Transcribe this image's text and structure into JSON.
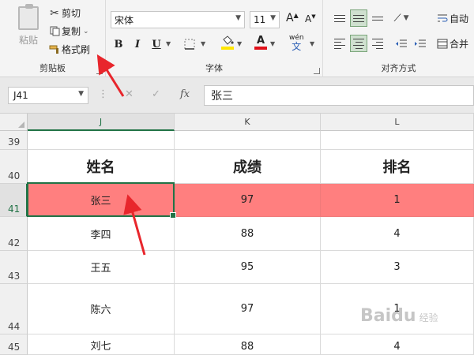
{
  "ribbon": {
    "clipboard": {
      "paste_label": "粘贴",
      "cut_label": "剪切",
      "copy_label": "复制",
      "format_painter_label": "格式刷",
      "group_label": "剪贴板"
    },
    "font": {
      "font_name": "宋体",
      "font_size": "11",
      "grow_label": "A",
      "shrink_label": "A",
      "bold": "B",
      "italic": "I",
      "underline": "U",
      "font_color_label": "A",
      "phonetic_top": "wén",
      "phonetic_bottom": "文",
      "group_label": "字体",
      "fill_color": "#ffe600",
      "font_color": "#e0101a"
    },
    "alignment": {
      "wrap_label": "自动",
      "merge_label": "合并",
      "group_label": "对齐方式"
    }
  },
  "formula_bar": {
    "name_box": "J41",
    "cancel_icon": "✕",
    "enter_icon": "✓",
    "fx_label": "fx",
    "formula": "张三"
  },
  "grid": {
    "columns": [
      "J",
      "K",
      "L"
    ],
    "rows": [
      "39",
      "40",
      "41",
      "42",
      "43",
      "44",
      "45"
    ],
    "header": {
      "name": "姓名",
      "score": "成绩",
      "rank": "排名"
    },
    "records": [
      {
        "name": "张三",
        "score": "97",
        "rank": "1",
        "highlight": true
      },
      {
        "name": "李四",
        "score": "88",
        "rank": "4"
      },
      {
        "name": "王五",
        "score": "95",
        "rank": "3"
      },
      {
        "name": "陈六",
        "score": "97",
        "rank": "1"
      },
      {
        "name": "刘七",
        "score": "88",
        "rank": "4"
      }
    ],
    "highlight_color": "#ff7f7f",
    "selection_color": "#217346"
  },
  "watermark": {
    "text": "Baidu",
    "sub": "经验"
  }
}
